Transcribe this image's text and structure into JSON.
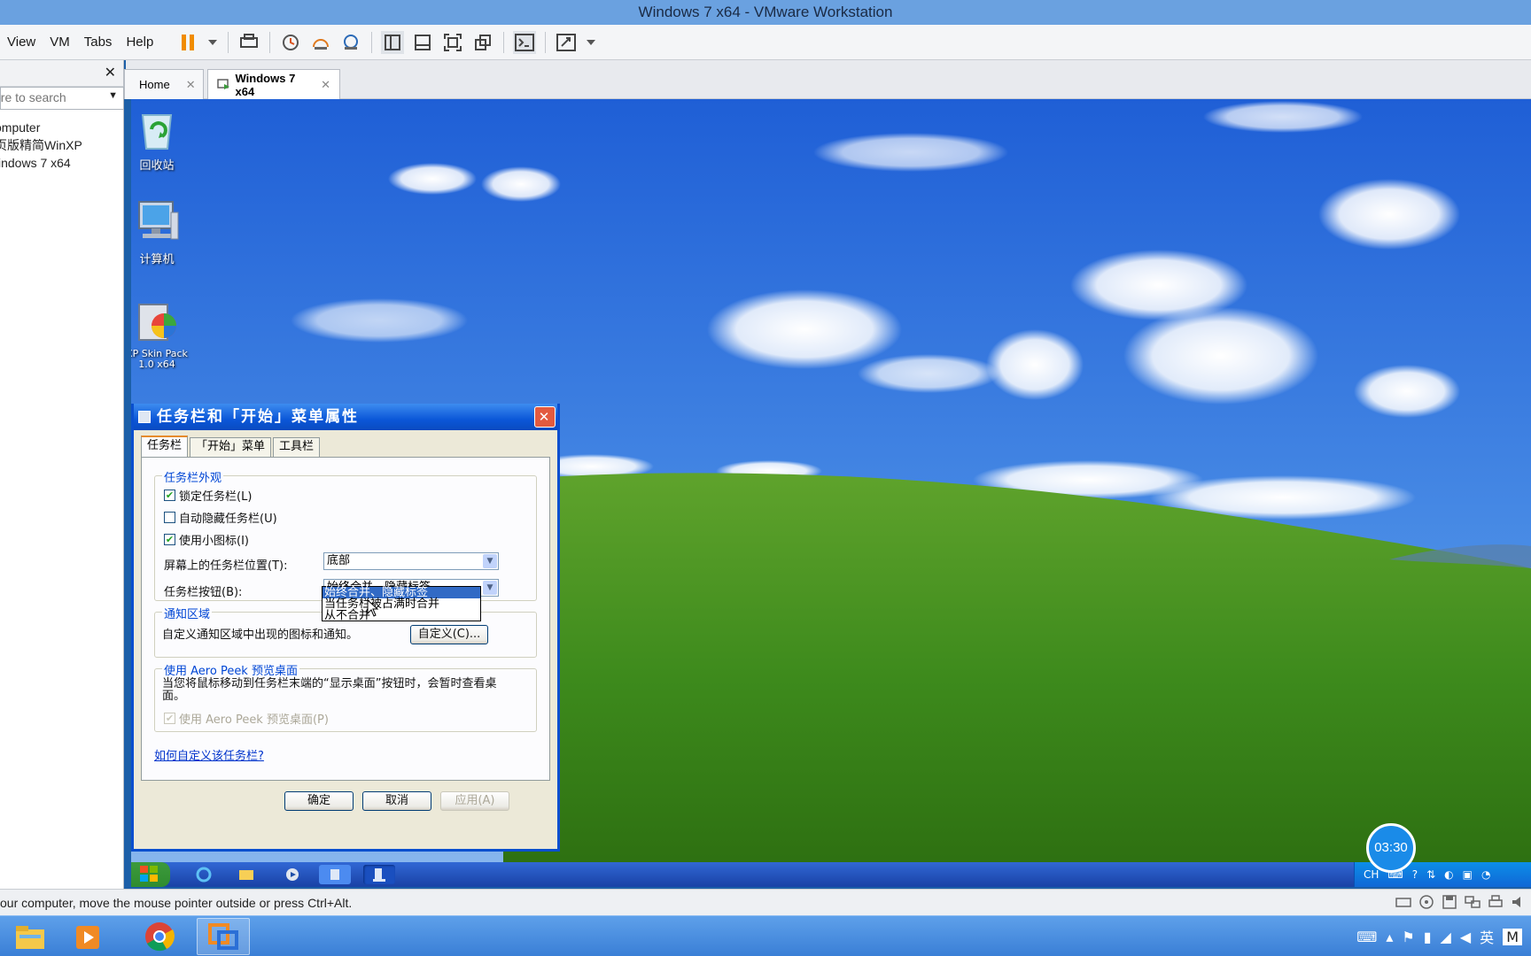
{
  "window": {
    "title": "Windows 7 x64 - VMware Workstation"
  },
  "menu": {
    "view": "View",
    "vm": "VM",
    "tabs": "Tabs",
    "help": "Help"
  },
  "library": {
    "search_placeholder": "ere to search",
    "items": [
      {
        "label": "omputer"
      },
      {
        "label": "页版精简WinXP"
      },
      {
        "label": "indows 7 x64"
      }
    ]
  },
  "vm_tabs": [
    {
      "label": "Home"
    },
    {
      "label": "Windows 7 x64"
    }
  ],
  "desktop": {
    "icons": [
      {
        "label": "回收站"
      },
      {
        "label": "计算机"
      },
      {
        "label": "XP Skin Pack 1.0 x64"
      }
    ]
  },
  "dialog": {
    "title": "任务栏和「开始」菜单属性",
    "tabs": [
      {
        "label": "任务栏"
      },
      {
        "label": "「开始」菜单"
      },
      {
        "label": "工具栏"
      }
    ],
    "appearance": {
      "title": "任务栏外观",
      "lock": {
        "label": "锁定任务栏(L)",
        "checked": true
      },
      "autohide": {
        "label": "自动隐藏任务栏(U)",
        "checked": false
      },
      "small_icons": {
        "label": "使用小图标(I)",
        "checked": true
      },
      "position_label": "屏幕上的任务栏位置(T):",
      "position_value": "底部",
      "buttons_label": "任务栏按钮(B):",
      "buttons_value": "始终合并、隐藏标签",
      "buttons_options": [
        "始终合并、隐藏标签",
        "当任务栏被占满时合并",
        "从不合并"
      ]
    },
    "notification": {
      "title": "通知区域",
      "text": "自定义通知区域中出现的图标和通知。",
      "customize_button": "自定义(C)..."
    },
    "aero": {
      "title": "使用 Aero Peek 预览桌面",
      "text": "当您将鼠标移动到任务栏末端的“显示桌面”按钮时，会暂时查看桌面。",
      "checkbox": {
        "label": "使用 Aero Peek 预览桌面(P)",
        "checked": true
      }
    },
    "help_link": "如何自定义该任务栏?",
    "ok": "确定",
    "cancel": "取消",
    "apply": "应用(A)"
  },
  "guest_tray": {
    "lang": "CH"
  },
  "timer": "03:30",
  "status": {
    "text": "our computer, move the mouse pointer outside or press Ctrl+Alt."
  },
  "host_tray": {
    "ime": "英",
    "ime2": "M"
  },
  "colors": {
    "xp_title_blue": "#0b57d8",
    "xp_taskbar": "#3168d5",
    "host_taskbar": "#4a8ee0"
  }
}
